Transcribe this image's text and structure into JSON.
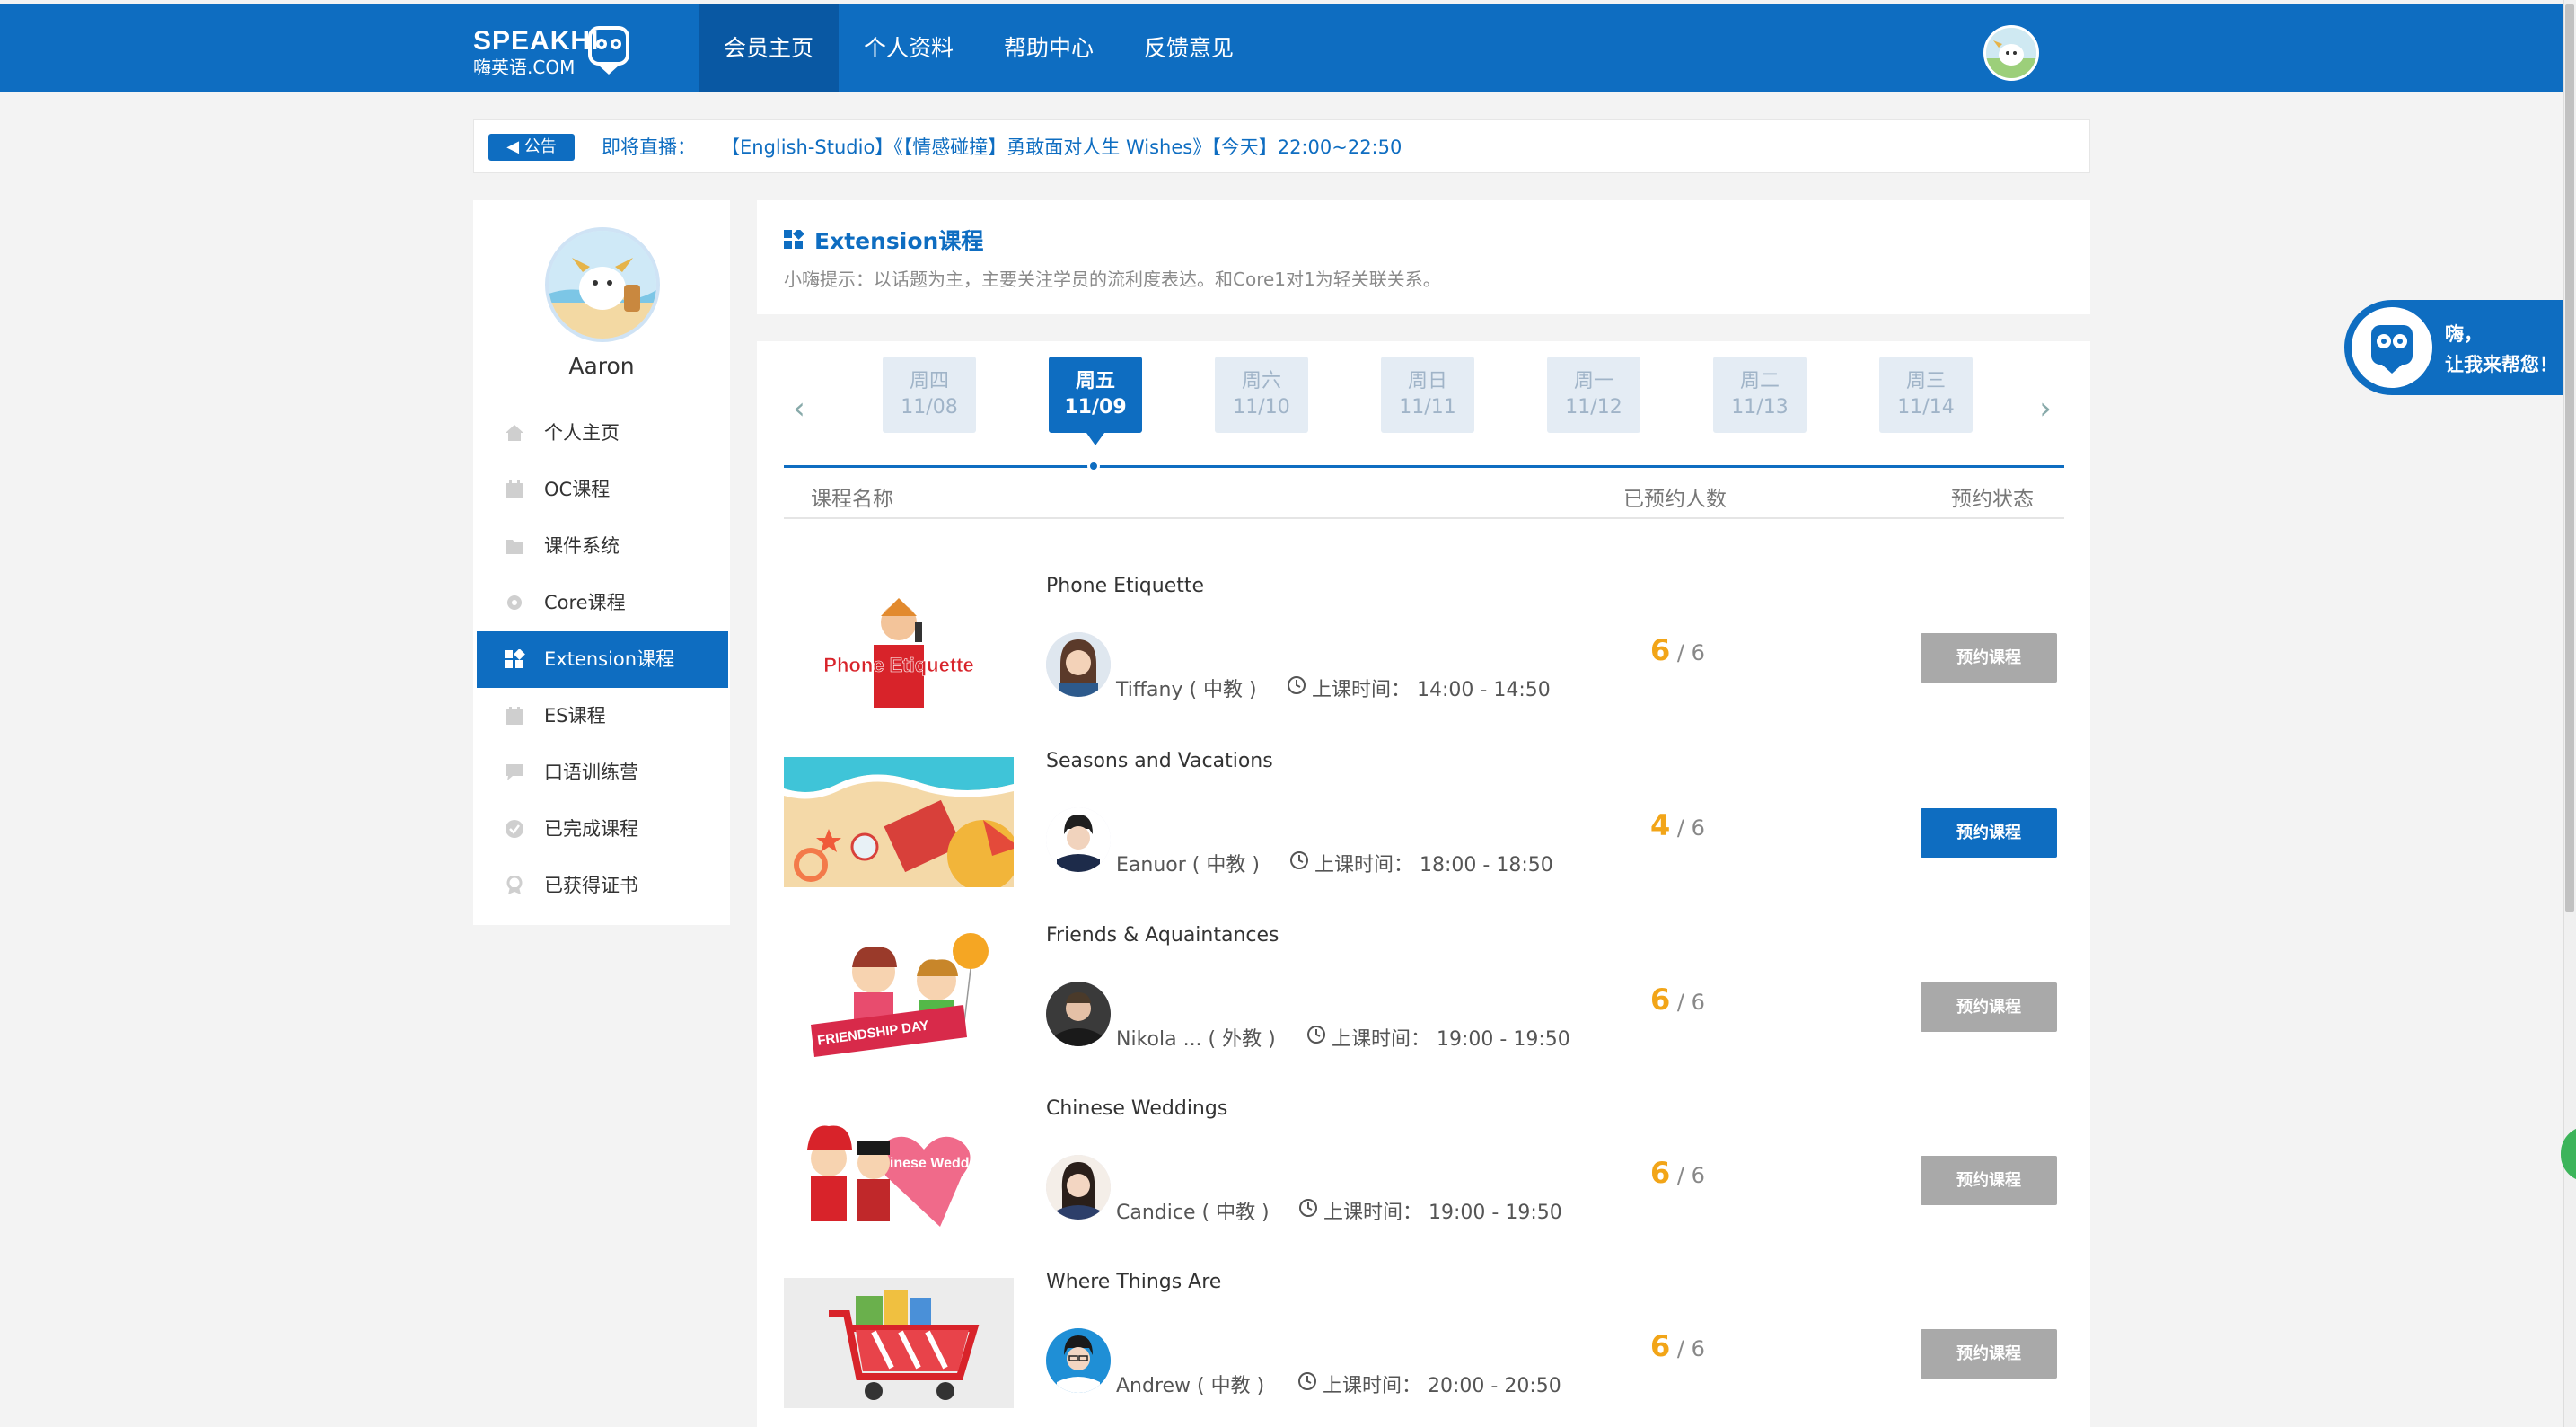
{
  "logo": {
    "brand": "SPEAKHI",
    "domain": "嗨英语.COM"
  },
  "nav": {
    "items": [
      {
        "label": "会员主页",
        "active": true
      },
      {
        "label": "个人资料",
        "active": false
      },
      {
        "label": "帮助中心",
        "active": false
      },
      {
        "label": "反馈意见",
        "active": false
      }
    ]
  },
  "notice": {
    "badge": "公告",
    "label": "即将直播：",
    "text": "【English-Studio】《【情感碰撞】勇敢面对人生 Wishes》【今天】22:00~22:50"
  },
  "sidebar": {
    "user_name": "Aaron",
    "items": [
      {
        "label": "个人主页",
        "icon": "home-icon",
        "active": false
      },
      {
        "label": "OC课程",
        "icon": "calendar-icon",
        "active": false
      },
      {
        "label": "课件系统",
        "icon": "folder-icon",
        "active": false
      },
      {
        "label": "Core课程",
        "icon": "gear-icon",
        "active": false
      },
      {
        "label": "Extension课程",
        "icon": "grid-icon",
        "active": true
      },
      {
        "label": "ES课程",
        "icon": "calendar-icon",
        "active": false
      },
      {
        "label": "口语训练营",
        "icon": "chat-icon",
        "active": false
      },
      {
        "label": "已完成课程",
        "icon": "check-circle-icon",
        "active": false
      },
      {
        "label": "已获得证书",
        "icon": "medal-icon",
        "active": false
      }
    ]
  },
  "header": {
    "title": "Extension课程",
    "tip": "小嗨提示：以话题为主，主要关注学员的流利度表达。和Core1对1为轻关联关系。"
  },
  "days": [
    {
      "weekday": "周四",
      "date": "11/08",
      "active": false
    },
    {
      "weekday": "周五",
      "date": "11/09",
      "active": true
    },
    {
      "weekday": "周六",
      "date": "11/10",
      "active": false
    },
    {
      "weekday": "周日",
      "date": "11/11",
      "active": false
    },
    {
      "weekday": "周一",
      "date": "11/12",
      "active": false
    },
    {
      "weekday": "周二",
      "date": "11/13",
      "active": false
    },
    {
      "weekday": "周三",
      "date": "11/14",
      "active": false
    }
  ],
  "table": {
    "col_name": "课程名称",
    "col_count": "已预约人数",
    "col_status": "预约状态"
  },
  "time_label": "上课时间：",
  "courses": [
    {
      "title": "Phone Etiquette",
      "thumb_text": "Phone Etiquette",
      "teacher": "Tiffany ( 中教 )",
      "time": "14:00 - 14:50",
      "booked": "6",
      "capacity": "/ 6",
      "button": "预约课程",
      "available": false
    },
    {
      "title": "Seasons and Vacations",
      "thumb_text": "",
      "teacher": "Eanuor ( 中教 )",
      "time": "18:00 - 18:50",
      "booked": "4",
      "capacity": "/ 6",
      "button": "预约课程",
      "available": true
    },
    {
      "title": "Friends & Aquaintances",
      "thumb_text": "FRIENDSHIP DAY",
      "teacher": "Nikola ... ( 外教 )",
      "time": "19:00 - 19:50",
      "booked": "6",
      "capacity": "/ 6",
      "button": "预约课程",
      "available": false
    },
    {
      "title": "Chinese Weddings",
      "thumb_text": "Chinese Weddings",
      "teacher": "Candice ( 中教 )",
      "time": "19:00 - 19:50",
      "booked": "6",
      "capacity": "/ 6",
      "button": "预约课程",
      "available": false
    },
    {
      "title": "Where Things Are",
      "thumb_text": "",
      "teacher": "Andrew ( 中教 )",
      "time": "20:00 - 20:50",
      "booked": "6",
      "capacity": "/ 6",
      "button": "预约课程",
      "available": false
    }
  ],
  "helper": {
    "line1": "嗨，",
    "line2": "让我来帮您！"
  },
  "colors": {
    "primary": "#0e6dc1",
    "accent": "#f2a518",
    "disabled": "#a9a9a9"
  }
}
